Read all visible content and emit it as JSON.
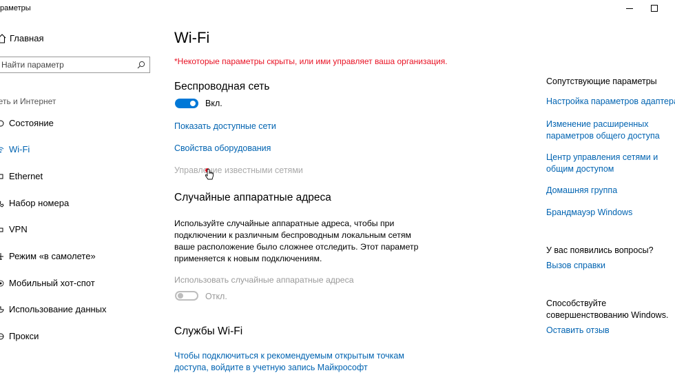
{
  "window": {
    "title": "Параметры"
  },
  "sidebar": {
    "home_label": "Главная",
    "search_placeholder": "Найти параметр",
    "section_label": "Сеть и Интернет",
    "items": [
      {
        "label": "Состояние",
        "icon": "globe-icon"
      },
      {
        "label": "Wi-Fi",
        "icon": "wifi-icon"
      },
      {
        "label": "Ethernet",
        "icon": "ethernet-icon"
      },
      {
        "label": "Набор номера",
        "icon": "phone-icon"
      },
      {
        "label": "VPN",
        "icon": "vpn-icon"
      },
      {
        "label": "Режим «в самолете»",
        "icon": "airplane-icon"
      },
      {
        "label": "Мобильный хот-спот",
        "icon": "hotspot-icon"
      },
      {
        "label": "Использование данных",
        "icon": "data-usage-icon"
      },
      {
        "label": "Прокси",
        "icon": "globe-icon"
      }
    ],
    "active_index": 1
  },
  "main": {
    "title": "Wi-Fi",
    "warning": "*Некоторые параметры скрыты, или ими управляет ваша организация.",
    "wireless_heading": "Беспроводная сеть",
    "wireless_toggle": {
      "state": "Вкл.",
      "on": true
    },
    "links": {
      "show_networks": "Показать доступные сети",
      "hardware_properties": "Свойства оборудования",
      "manage_known": "Управление известными сетями"
    },
    "random_heading": "Случайные аппаратные адреса",
    "random_description": [
      "Используйте случайные аппаратные адреса, чтобы при",
      "подключении к различным беспроводным локальным сетям",
      "ваше расположение было сложнее отследить. Этот параметр",
      "применяется к новым подключениям."
    ],
    "random_toggle_label": "Использовать случайные аппаратные адреса",
    "random_toggle": {
      "state": "Откл.",
      "on": false
    },
    "services_heading": "Службы Wi-Fi",
    "services_link": [
      "Чтобы подключиться к рекомендуемым открытым точкам",
      "доступа, войдите в учетную запись Майкрософт"
    ]
  },
  "related": {
    "heading": "Сопутствующие параметры",
    "adapter_settings": "Настройка параметров адаптера",
    "sharing_settings": [
      "Изменение расширенных",
      "параметров общего доступа"
    ],
    "network_center": [
      "Центр управления сетями и",
      "общим доступом"
    ],
    "homegroup": "Домашняя группа",
    "firewall": "Брандмауэр Windows"
  },
  "help": {
    "heading": "У вас появились вопросы?",
    "get_help": "Вызов справки"
  },
  "feedback": {
    "heading": [
      "Способствуйте",
      "совершенствованию Windows."
    ],
    "give_feedback": "Оставить отзыв"
  },
  "colors": {
    "accent": "#0078d7",
    "link": "#0063b1",
    "warning": "#e81123",
    "disabled": "#9a9a9a"
  }
}
